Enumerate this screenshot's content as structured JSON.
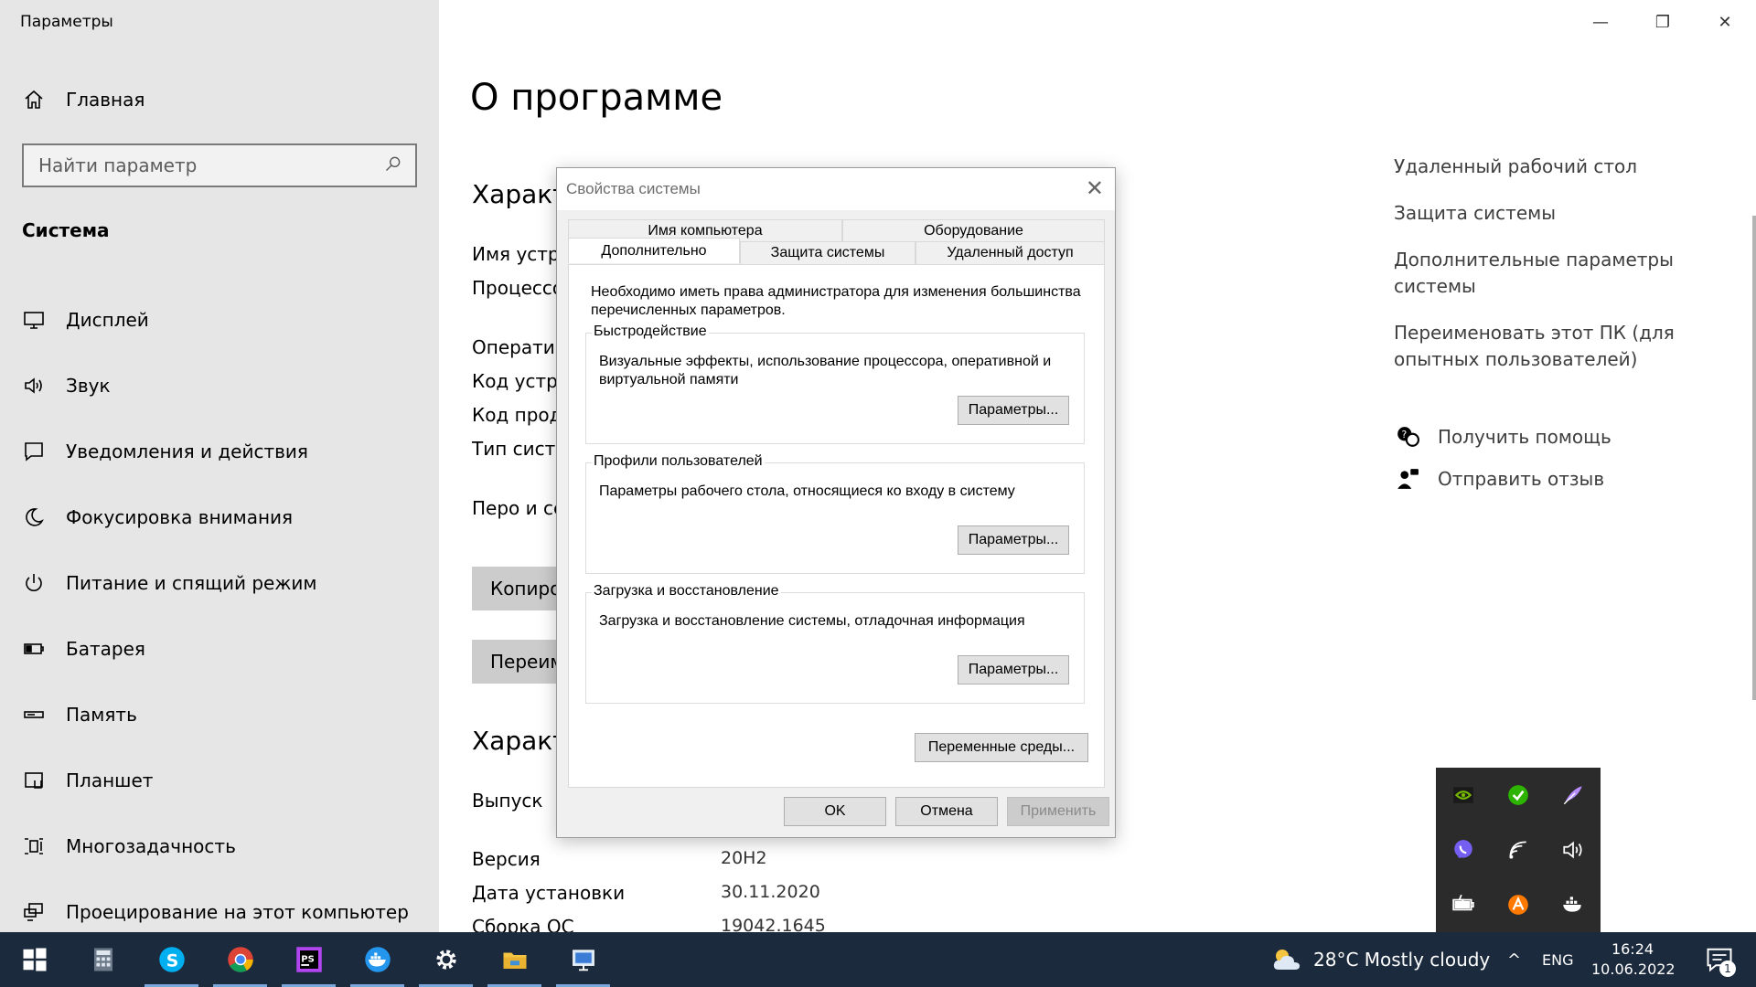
{
  "window": {
    "title": "Параметры",
    "controls": {
      "minimize": "—",
      "maximize": "❐",
      "close": "✕"
    }
  },
  "sidebar": {
    "home_label": "Главная",
    "search_placeholder": "Найти параметр",
    "section_title": "Система",
    "items": [
      {
        "label": "Дисплей",
        "icon": "display-icon"
      },
      {
        "label": "Звук",
        "icon": "sound-icon"
      },
      {
        "label": "Уведомления и действия",
        "icon": "notifications-icon"
      },
      {
        "label": "Фокусировка внимания",
        "icon": "focus-moon-icon"
      },
      {
        "label": "Питание и спящий режим",
        "icon": "power-icon"
      },
      {
        "label": "Батарея",
        "icon": "battery-icon"
      },
      {
        "label": "Память",
        "icon": "storage-icon"
      },
      {
        "label": "Планшет",
        "icon": "tablet-icon"
      },
      {
        "label": "Многозадачность",
        "icon": "multitasking-icon"
      },
      {
        "label": "Проецирование на этот компьютер",
        "icon": "projecting-icon"
      }
    ]
  },
  "main": {
    "title": "О программе",
    "device_heading": "Характ",
    "device_rows": [
      "Имя устр",
      "Процессо",
      "Оператив",
      "Код устро",
      "Код проду",
      "Тип систе",
      "Перо и се"
    ],
    "copy_button": "Копиро",
    "rename_button": "Переим",
    "windows_heading": "Характ",
    "windows_rows": [
      {
        "label": "Выпуск",
        "value": ""
      },
      {
        "label": "Версия",
        "value": "20H2"
      },
      {
        "label": "Дата установки",
        "value": "30.11.2020"
      },
      {
        "label": "Сборка ОС",
        "value": "19042.1645"
      }
    ]
  },
  "related": {
    "links": [
      "Удаленный рабочий стол",
      "Защита системы",
      "Дополнительные параметры системы",
      "Переименовать этот ПК (для опытных пользователей)"
    ],
    "help": "Получить помощь",
    "feedback": "Отправить отзыв"
  },
  "dialog": {
    "title": "Свойства системы",
    "close": "✕",
    "tabs_top": [
      "Имя компьютера",
      "Оборудование"
    ],
    "tabs_bottom": [
      "Дополнительно",
      "Защита системы",
      "Удаленный доступ"
    ],
    "active_tab": "Дополнительно",
    "admin_note": "Необходимо иметь права администратора для изменения большинства перечисленных параметров.",
    "groups": [
      {
        "title": "Быстродействие",
        "description": "Визуальные эффекты, использование процессора, оперативной и виртуальной памяти",
        "button": "Параметры..."
      },
      {
        "title": "Профили пользователей",
        "description": "Параметры рабочего стола, относящиеся ко входу в систему",
        "button": "Параметры..."
      },
      {
        "title": "Загрузка и восстановление",
        "description": "Загрузка и восстановление системы, отладочная информация",
        "button": "Параметры..."
      }
    ],
    "env_button": "Переменные среды...",
    "ok": "OK",
    "cancel": "Отмена",
    "apply": "Применить"
  },
  "tray_popup": {
    "icons": [
      "nvidia-icon",
      "security-check-icon",
      "feather-icon",
      "viber-icon",
      "wifi-icon",
      "volume-icon",
      "battery-tray-icon",
      "avast-icon",
      "docker-icon"
    ],
    "colors": {
      "nvidia": "#76b900",
      "check": "#2db400",
      "feather": "#b68cff",
      "viber": "#7360f2",
      "avast": "#ff7800"
    }
  },
  "taskbar": {
    "apps": [
      "windows-start-icon",
      "calculator-icon",
      "skype-icon",
      "chrome-icon",
      "phpstorm-icon",
      "docker-icon",
      "settings-gear-icon",
      "file-explorer-icon",
      "remote-desktop-icon"
    ],
    "weather": "28°C  Mostly cloudy",
    "chevron": "^",
    "language": "ENG",
    "time": "16:24",
    "date": "10.06.2022",
    "notification_count": "1"
  }
}
